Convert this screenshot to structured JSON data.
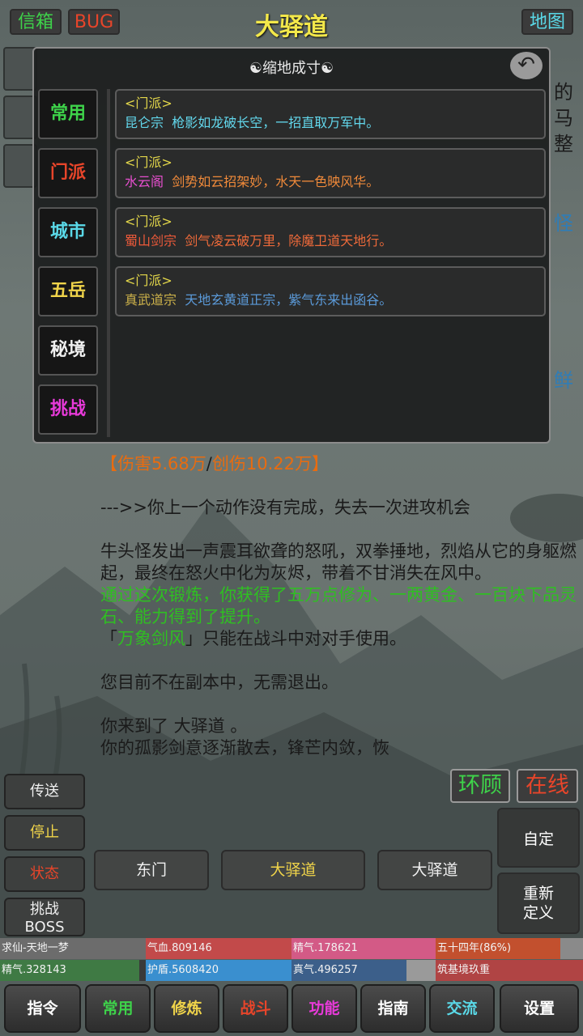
{
  "header": {
    "mail_label": "信箱",
    "bug_label": "BUG",
    "title": "大驿道",
    "map_label": "地图"
  },
  "popup": {
    "title": "☯缩地成寸☯",
    "tabs": [
      {
        "label": "常用",
        "color": "#3ed34a"
      },
      {
        "label": "门派",
        "color": "#e8452a"
      },
      {
        "label": "城市",
        "color": "#5ad9e8"
      },
      {
        "label": "五岳",
        "color": "#f0d44a"
      },
      {
        "label": "秘境",
        "color": "#f0f0f0"
      },
      {
        "label": "挑战",
        "color": "#e83ad9"
      }
    ],
    "entries": [
      {
        "tag": "<门派>",
        "name": "昆仑宗",
        "desc": "枪影如龙破长空，一招直取万军中。",
        "name_color": "#62d7ec",
        "desc_color": "#62d7ec"
      },
      {
        "tag": "<门派>",
        "name": "水云阁",
        "desc": "剑势如云招架妙，水天一色映风华。",
        "name_color": "#e74fcf",
        "desc_color": "#f08a3a"
      },
      {
        "tag": "<门派>",
        "name": "蜀山剑宗",
        "desc": "剑气凌云破万里，除魔卫道天地行。",
        "name_color": "#ee5a3a",
        "desc_color": "#ee6a3a"
      },
      {
        "tag": "<门派>",
        "name": "真武道宗",
        "desc": "天地玄黄道正宗，紫气东来出函谷。",
        "name_color": "#cdb24a",
        "desc_color": "#5b9ad9"
      }
    ]
  },
  "story": {
    "partial_right": [
      "的",
      "马",
      "整",
      "怪",
      "鲜"
    ],
    "damage_open": "【",
    "damage": "伤害5.68万",
    "slash": "/",
    "crit": "创伤10.22万",
    "damage_close": "】",
    "line_missed": "--->>你上一个动作没有完成，失去一次进攻机会",
    "line_boss": "牛头怪发出一声震耳欲聋的怒吼，双拳捶地，烈焰从它的身躯燃起，最终在怒火中化为灰烬，带着不甘消失在风中。",
    "line_reward": "通过这次锻炼，你获得了五万点修为、一两黄金、一百块下品灵石、能力得到了提升。",
    "skill_open": "「",
    "skill_name": "万象剑风",
    "skill_rest": "」只能在战斗中对对手使用。",
    "line_instance": "您目前不在副本中，无需退出。",
    "line_arrive": "你来到了 大驿道 。",
    "line_fade": "你的孤影剑意逐渐散去，锋芒内敛，恢"
  },
  "float_buttons": {
    "look_label": "环顾",
    "online_label": "在线"
  },
  "left_actions": {
    "teleport": "传送",
    "stop": "停止",
    "status": "状态",
    "boss_line1": "挑战",
    "boss_line2": "BOSS"
  },
  "exits": [
    "东门",
    "大驿道",
    "大驿道"
  ],
  "right_actions": {
    "custom": "自定",
    "redefine_line1": "重新",
    "redefine_line2": "定义"
  },
  "stats": {
    "player": "求仙-天地一梦",
    "hp": "气血.809146",
    "essence": "精气.178621",
    "age": "五十四年(86%)",
    "jingqi": "精气.328143",
    "shield": "护盾.5608420",
    "zhenqi": "真气.496257",
    "realm": "筑基境玖重"
  },
  "nav": [
    {
      "label": "指令",
      "color": "#ffffff"
    },
    {
      "label": "常用",
      "color": "#3ed34a"
    },
    {
      "label": "修炼",
      "color": "#f0d44a"
    },
    {
      "label": "战斗",
      "color": "#e8452a"
    },
    {
      "label": "功能",
      "color": "#e83ad9"
    },
    {
      "label": "指南",
      "color": "#ffffff"
    },
    {
      "label": "交流",
      "color": "#5ad9e8"
    },
    {
      "label": "设置",
      "color": "#ffffff"
    }
  ]
}
